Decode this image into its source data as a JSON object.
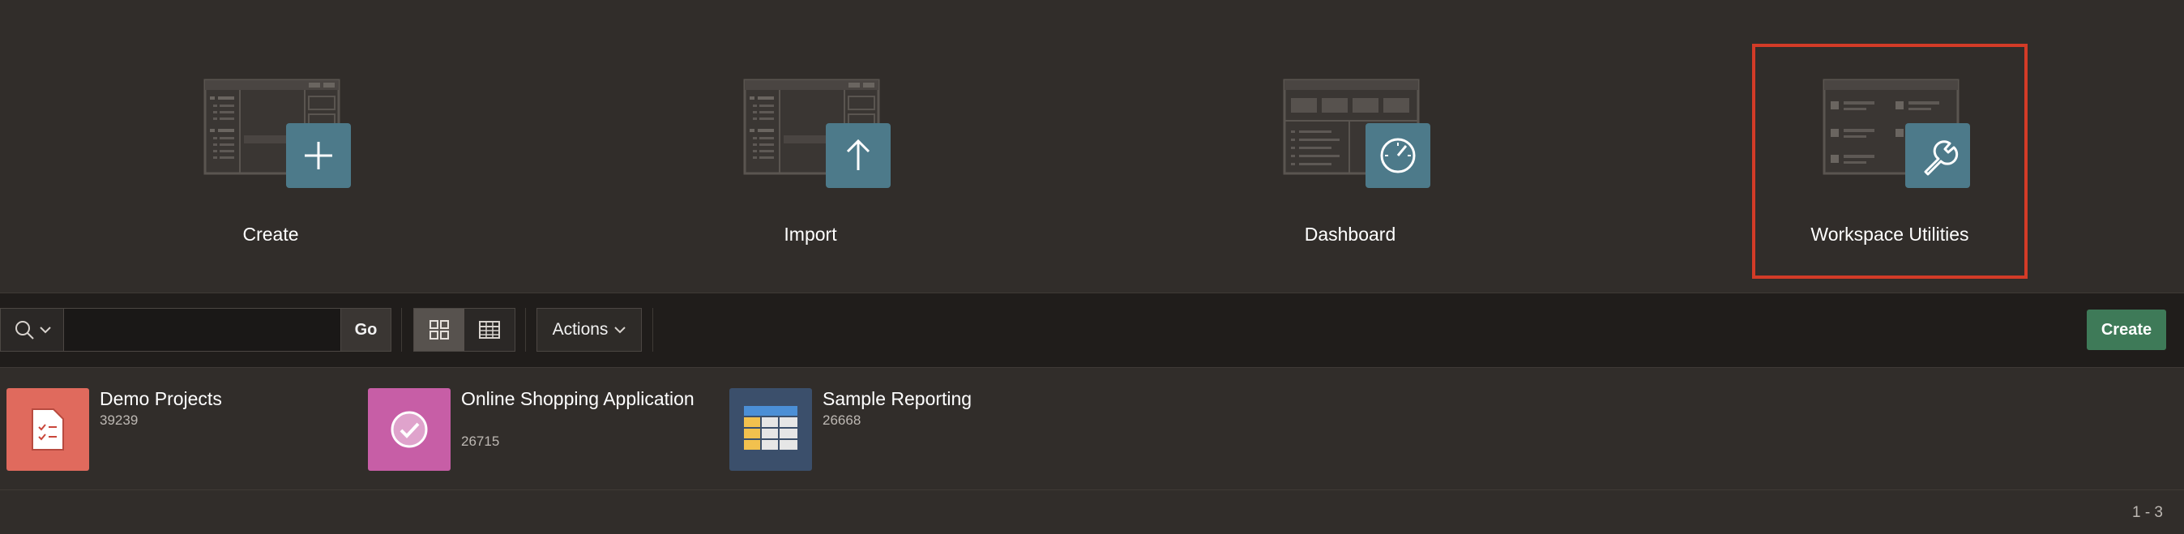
{
  "hero": {
    "tiles": [
      {
        "label": "Create",
        "badge_icon": "plus-icon"
      },
      {
        "label": "Import",
        "badge_icon": "arrow-up-icon"
      },
      {
        "label": "Dashboard",
        "badge_icon": "speedometer-icon"
      },
      {
        "label": "Workspace Utilities",
        "badge_icon": "wrench-icon",
        "highlighted": true
      }
    ]
  },
  "toolbar": {
    "search_value": "",
    "go_label": "Go",
    "actions_label": "Actions",
    "create_label": "Create",
    "active_view": "icons"
  },
  "apps": [
    {
      "name": "Demo Projects",
      "id": "39239",
      "color": "#e06a5d"
    },
    {
      "name": "Online Shopping Application",
      "id": "26715",
      "color": "#c75ea6"
    },
    {
      "name": "Sample Reporting",
      "id": "26668",
      "color": "#3b4f6b"
    }
  ],
  "pagination": "1 - 3",
  "colors": {
    "background": "#312d2a",
    "toolbar": "#201d1b",
    "badge": "#4d7a8a",
    "highlight": "#d33b27",
    "create_button": "#3e7a58"
  }
}
